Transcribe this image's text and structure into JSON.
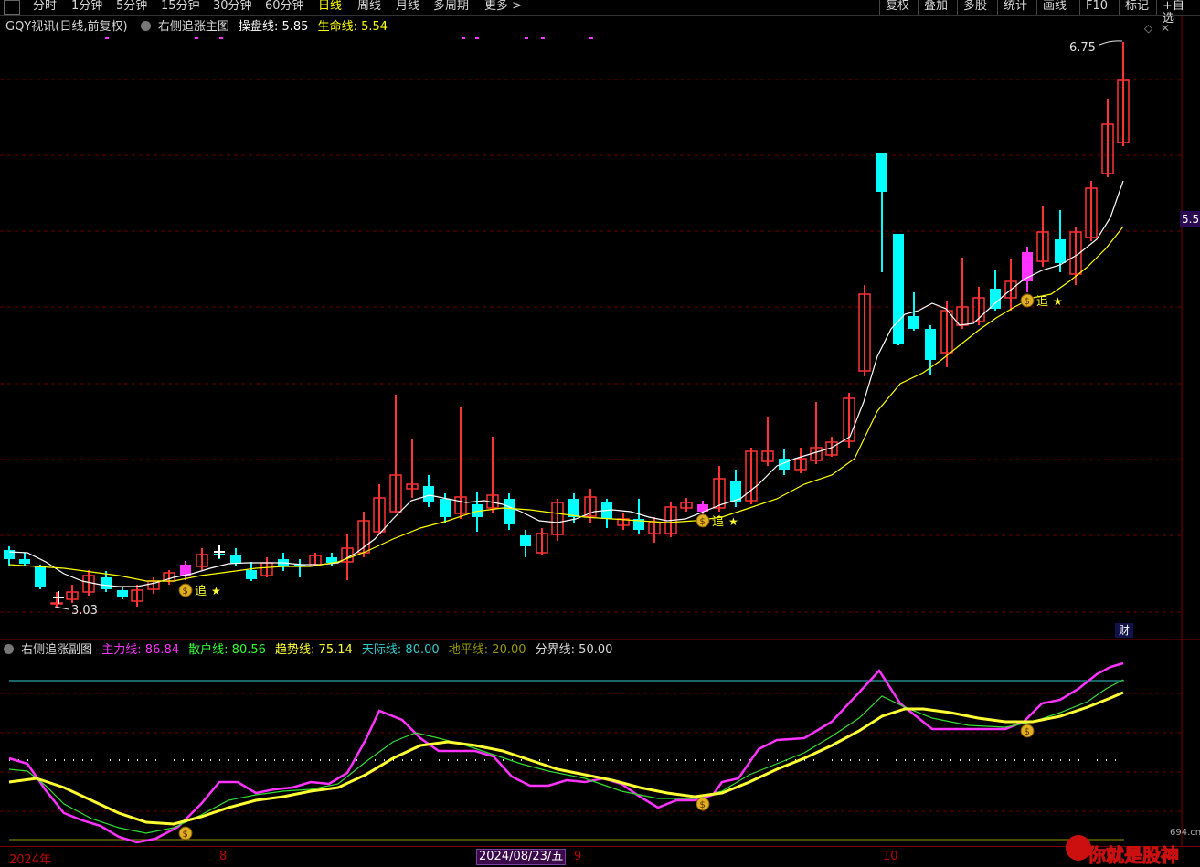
{
  "toolbar": {
    "items": [
      "分时",
      "1分钟",
      "5分钟",
      "15分钟",
      "30分钟",
      "60分钟",
      "日线",
      "周线",
      "月线",
      "多周期",
      "更多 >"
    ],
    "active_index": 6,
    "right_items": [
      "复权",
      "叠加",
      "多股",
      "统计",
      "画线",
      "F10",
      "标记",
      "+自选"
    ]
  },
  "main_title": {
    "stock": "GQY视讯(日线,前复权)",
    "indicator": "右侧追涨主图",
    "op_label": "操盘线: 5.85",
    "life_label": "生命线: 5.54"
  },
  "sub_title": {
    "indicator": "右侧追涨副图",
    "items": [
      {
        "text": "主力线: 86.84",
        "color": "#ff33ff"
      },
      {
        "text": "散户线: 80.56",
        "color": "#33ff33"
      },
      {
        "text": "趋势线: 75.14",
        "color": "#ffff33"
      },
      {
        "text": "天际线: 80.00",
        "color": "#33cccc"
      },
      {
        "text": "地平线: 20.00",
        "color": "#999900"
      },
      {
        "text": "分界线: 50.00",
        "color": "#dddddd"
      }
    ]
  },
  "annotations": {
    "high": "6.75",
    "low": "3.03",
    "chase": "追",
    "price_tag": "5.5",
    "cai": "财"
  },
  "axis": {
    "year": "2024年",
    "m8": "8",
    "date": "2024/08/23/五",
    "m9": "9",
    "m10": "10"
  },
  "watermark": {
    "text": "你就是股神",
    "site": "694.cn"
  },
  "colors": {
    "up": "#ff3333",
    "down": "#00ffff",
    "op_line": "#ffffff",
    "life_line": "#ffff00",
    "grid": "#7a0000"
  }
}
